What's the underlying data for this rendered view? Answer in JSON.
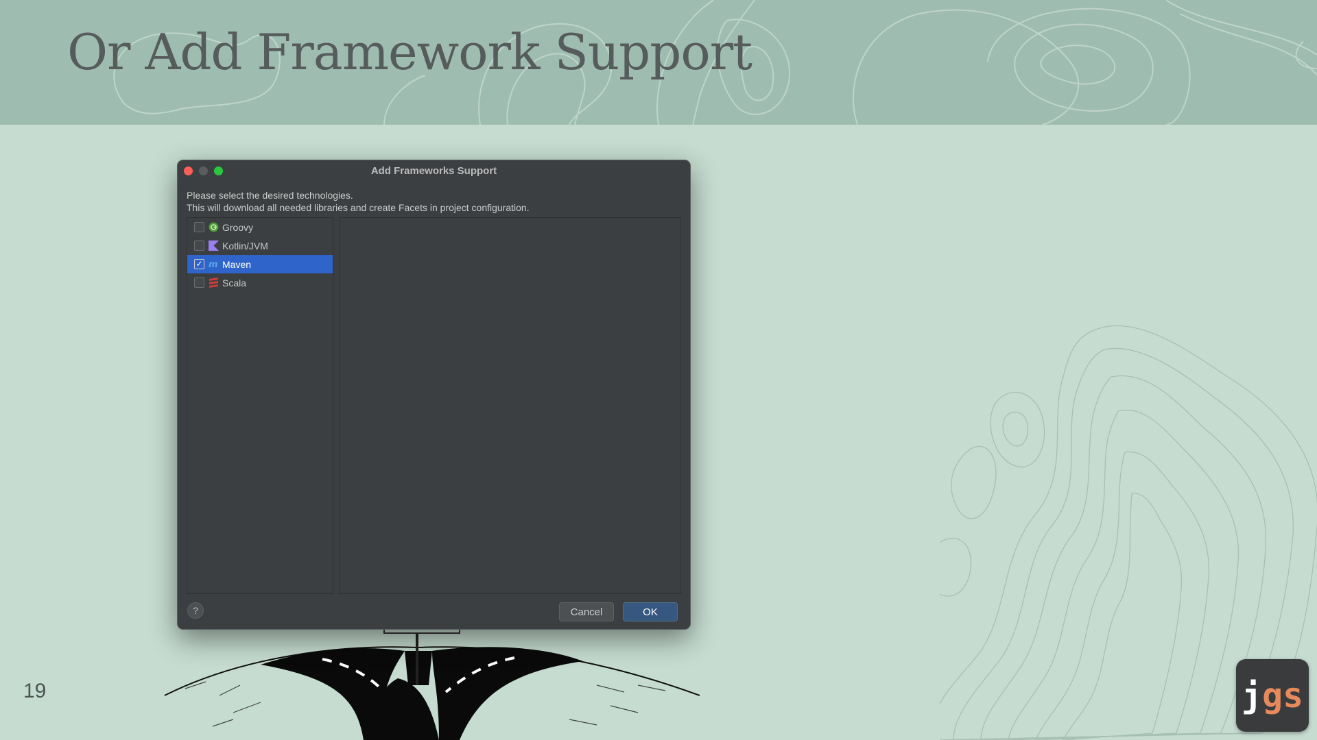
{
  "slide": {
    "title": "Or Add Framework Support",
    "page_number": "19"
  },
  "logo": {
    "j": "j",
    "gs": "gs"
  },
  "dialog": {
    "title": "Add Frameworks Support",
    "description_line1": "Please select the desired technologies.",
    "description_line2": "This will download all needed libraries and create Facets in project configuration.",
    "frameworks": [
      {
        "label": "Groovy",
        "checked": false,
        "icon": "groovy-icon",
        "icon_color": "#4e9a3a"
      },
      {
        "label": "Kotlin/JVM",
        "checked": false,
        "icon": "kotlin-icon",
        "icon_color": "#9b7ef0"
      },
      {
        "label": "Maven",
        "checked": true,
        "selected": true,
        "icon": "maven-icon",
        "icon_color": "#5aa4ec"
      },
      {
        "label": "Scala",
        "checked": false,
        "icon": "scala-icon",
        "icon_color": "#d33a3a"
      }
    ],
    "check_mark": "✓",
    "help_label": "?",
    "cancel_label": "Cancel",
    "ok_label": "OK"
  },
  "colors": {
    "background": "#c6dcd0",
    "header": "#9ebcb0",
    "dialog_bg": "#3c3f41",
    "selection": "#2f65ca",
    "ok_button": "#365880",
    "logo_accent": "#e68a5c"
  }
}
